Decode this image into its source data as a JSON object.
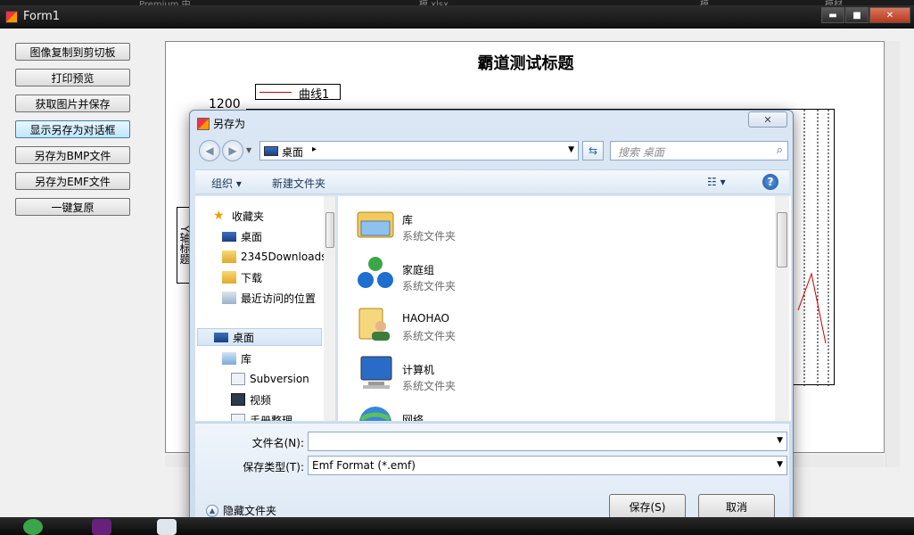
{
  "top_strip": {
    "items": [
      "Premium 中",
      "模 xlsx",
      "模",
      "模材"
    ]
  },
  "form": {
    "title": "Form1",
    "buttons": [
      "图像复制到剪切板",
      "打印预览",
      "获取图片并保存",
      "显示另存为对话框",
      "另存为BMP文件",
      "另存为EMF文件",
      "一键复原"
    ],
    "window_controls": {
      "minimize": "▬",
      "maximize": "■",
      "close": "✕"
    }
  },
  "chart_data": {
    "type": "line",
    "title": "霸道测试标题",
    "legend": [
      {
        "name": "曲线1",
        "color": "#cc0000"
      }
    ],
    "ylabel": "Y轴标题",
    "visible_y_ticks": [
      "1200"
    ],
    "series": [
      {
        "name": "曲线1",
        "visible_segment": [
          {
            "y": "rise"
          },
          {
            "y": "peak"
          },
          {
            "y": "fall"
          }
        ]
      }
    ]
  },
  "dialog": {
    "title": "另存为",
    "close": "✕",
    "address": {
      "location": "桌面",
      "separator": "▸"
    },
    "search": {
      "placeholder": "搜索 桌面"
    },
    "toolbar": {
      "organize": "组织 ▾",
      "new_folder": "新建文件夹",
      "view": "▾"
    },
    "nav": [
      {
        "label": "收藏夹",
        "icon": "star-icon"
      },
      {
        "label": "桌面",
        "icon": "desktop-icon"
      },
      {
        "label": "2345Downloads",
        "icon": "folder-icon"
      },
      {
        "label": "下载",
        "icon": "download-folder-icon"
      },
      {
        "label": "最近访问的位置",
        "icon": "recent-places-icon"
      },
      {
        "label": "桌面",
        "icon": "desktop-icon"
      },
      {
        "label": "库",
        "icon": "library-icon"
      },
      {
        "label": "Subversion",
        "icon": "document-icon"
      },
      {
        "label": "视频",
        "icon": "video-icon"
      },
      {
        "label": "手册整理",
        "icon": "document-icon"
      }
    ],
    "content": [
      {
        "name": "库",
        "type": "系统文件夹",
        "icon": "library-icon"
      },
      {
        "name": "家庭组",
        "type": "系统文件夹",
        "icon": "homegroup-icon"
      },
      {
        "name": "HAOHAO",
        "type": "系统文件夹",
        "icon": "user-folder-icon"
      },
      {
        "name": "计算机",
        "type": "系统文件夹",
        "icon": "computer-icon"
      },
      {
        "name": "网络",
        "type": "",
        "icon": "network-icon"
      }
    ],
    "filename": {
      "label": "文件名(N):",
      "value": ""
    },
    "filetype": {
      "label": "保存类型(T):",
      "value": "Emf Format (*.emf)"
    },
    "hide_folders": "隐藏文件夹",
    "save": "保存(S)",
    "cancel": "取消"
  }
}
